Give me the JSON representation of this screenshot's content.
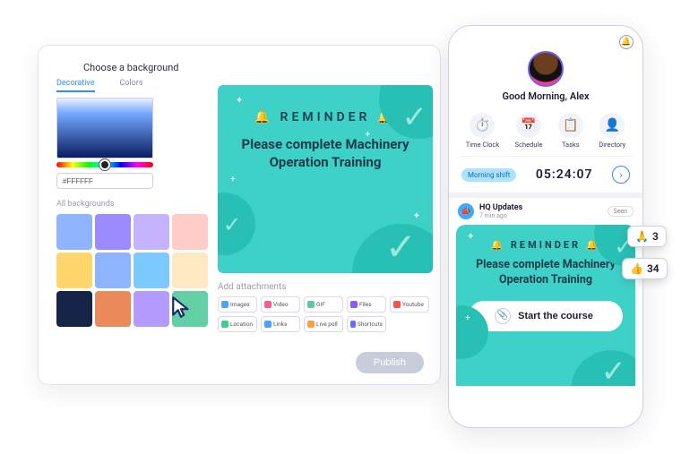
{
  "editor": {
    "title": "Choose a background",
    "tabs": {
      "decorative": "Decorative",
      "colors": "Colors"
    },
    "hex_value": "#FFFFFF",
    "all_backgrounds_label": "All backgrounds",
    "thumbnails": [
      "#8fb4ff",
      "#9a8bff",
      "#c5b3ff",
      "#ffccc7",
      "#ffd66b",
      "#8fb4ff",
      "#7cc9ff",
      "#ffe9c2",
      "#152447",
      "#ea8a5b",
      "#b49bff",
      "#63cfa5"
    ],
    "preview": {
      "reminder_word": "REMINDER",
      "body": "Please complete Machinery Operation Training",
      "bell_emoji": "🔔"
    },
    "attachments": {
      "label": "Add attachments",
      "items": [
        {
          "label": "Images",
          "color": "#4aa3ff"
        },
        {
          "label": "Video",
          "color": "#ff5a8a"
        },
        {
          "label": "GIF",
          "color": "#5ac8a8"
        },
        {
          "label": "Files",
          "color": "#8a5aff"
        },
        {
          "label": "Youtube",
          "color": "#ff4d4d"
        },
        {
          "label": "Location",
          "color": "#3ad18e"
        },
        {
          "label": "Links",
          "color": "#4aa3ff"
        },
        {
          "label": "Live poll",
          "color": "#ff9f40"
        },
        {
          "label": "Shortcuts",
          "color": "#6a6aff"
        }
      ]
    },
    "publish_label": "Publish"
  },
  "phone": {
    "greeting": "Good Morning, Alex",
    "quick": [
      {
        "label": "Time Clock",
        "icon": "⏱️",
        "tint": "#3a82ff"
      },
      {
        "label": "Schedule",
        "icon": "📅",
        "tint": "#ff9f40"
      },
      {
        "label": "Tasks",
        "icon": "📋",
        "tint": "#6a5bff"
      },
      {
        "label": "Directory",
        "icon": "👤",
        "tint": "#ff5a8a"
      }
    ],
    "shift": {
      "pill": "Morning shift",
      "time": "05:24:07"
    },
    "feed": {
      "source": "HQ Updates",
      "time": "7 min ago",
      "seen_label": "Seen",
      "reminder_word": "REMINDER",
      "body": "Please complete Machinery Operation Training",
      "bell_emoji": "🔔",
      "start_label": "Start the course"
    }
  },
  "reactions": {
    "pray": {
      "emoji": "🙏",
      "count": "3"
    },
    "thumbs": {
      "emoji": "👍",
      "count": "34"
    }
  }
}
